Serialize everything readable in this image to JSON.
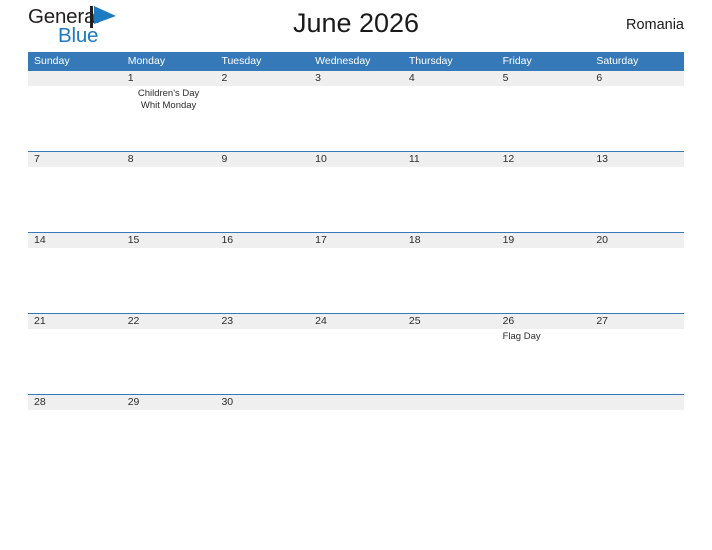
{
  "brand": {
    "name_part1": "General",
    "name_part2": "Blue",
    "flag_icon": "flag-icon",
    "color_dark": "#231f20",
    "color_blue": "#1c7ac0"
  },
  "header": {
    "title": "June 2026",
    "country": "Romania"
  },
  "calendar": {
    "accent_color": "#3679b9",
    "band_color": "#efeff0",
    "weekdays": [
      "Sunday",
      "Monday",
      "Tuesday",
      "Wednesday",
      "Thursday",
      "Friday",
      "Saturday"
    ],
    "weeks": [
      {
        "days": [
          {
            "number": "",
            "events": []
          },
          {
            "number": "1",
            "events": [
              "Children's Day",
              "Whit Monday"
            ],
            "align": "center"
          },
          {
            "number": "2",
            "events": []
          },
          {
            "number": "3",
            "events": []
          },
          {
            "number": "4",
            "events": []
          },
          {
            "number": "5",
            "events": []
          },
          {
            "number": "6",
            "events": []
          }
        ]
      },
      {
        "days": [
          {
            "number": "7",
            "events": []
          },
          {
            "number": "8",
            "events": []
          },
          {
            "number": "9",
            "events": []
          },
          {
            "number": "10",
            "events": []
          },
          {
            "number": "11",
            "events": []
          },
          {
            "number": "12",
            "events": []
          },
          {
            "number": "13",
            "events": []
          }
        ]
      },
      {
        "days": [
          {
            "number": "14",
            "events": []
          },
          {
            "number": "15",
            "events": []
          },
          {
            "number": "16",
            "events": []
          },
          {
            "number": "17",
            "events": []
          },
          {
            "number": "18",
            "events": []
          },
          {
            "number": "19",
            "events": []
          },
          {
            "number": "20",
            "events": []
          }
        ]
      },
      {
        "days": [
          {
            "number": "21",
            "events": []
          },
          {
            "number": "22",
            "events": []
          },
          {
            "number": "23",
            "events": []
          },
          {
            "number": "24",
            "events": []
          },
          {
            "number": "25",
            "events": []
          },
          {
            "number": "26",
            "events": [
              "Flag Day"
            ],
            "align": "left"
          },
          {
            "number": "27",
            "events": []
          }
        ]
      },
      {
        "days": [
          {
            "number": "28",
            "events": []
          },
          {
            "number": "29",
            "events": []
          },
          {
            "number": "30",
            "events": []
          },
          {
            "number": "",
            "events": []
          },
          {
            "number": "",
            "events": []
          },
          {
            "number": "",
            "events": []
          },
          {
            "number": "",
            "events": []
          }
        ]
      }
    ]
  }
}
